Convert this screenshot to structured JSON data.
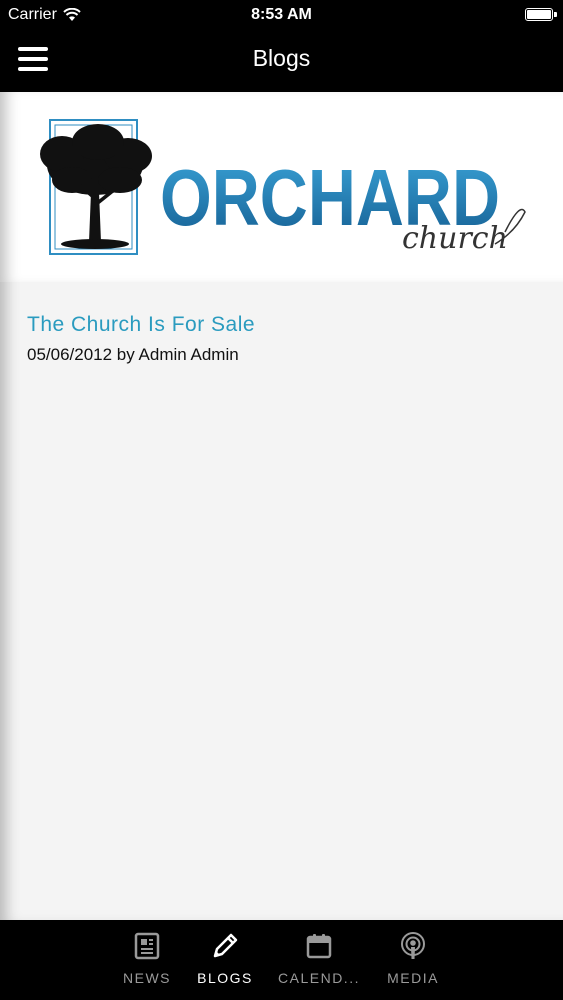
{
  "status_bar": {
    "carrier": "Carrier",
    "time": "8:53 AM"
  },
  "nav": {
    "title": "Blogs",
    "menu_icon": "hamburger-menu-icon"
  },
  "logo": {
    "text": "ORCHARD",
    "subtext": "church",
    "brand_color": "#1f7fb3"
  },
  "posts": [
    {
      "title": "The Church Is For Sale",
      "meta": "05/06/2012 by Admin Admin"
    }
  ],
  "tabs": [
    {
      "label": "NEWS",
      "icon": "newspaper-icon",
      "active": false
    },
    {
      "label": "BLOGS",
      "icon": "pencil-icon",
      "active": true
    },
    {
      "label": "CALEND...",
      "icon": "calendar-icon",
      "active": false
    },
    {
      "label": "MEDIA",
      "icon": "podcast-icon",
      "active": false
    }
  ],
  "colors": {
    "link": "#2a9bbf",
    "bar": "#000000",
    "active_tab": "#ffffff",
    "inactive_tab": "#9a9a9a"
  }
}
